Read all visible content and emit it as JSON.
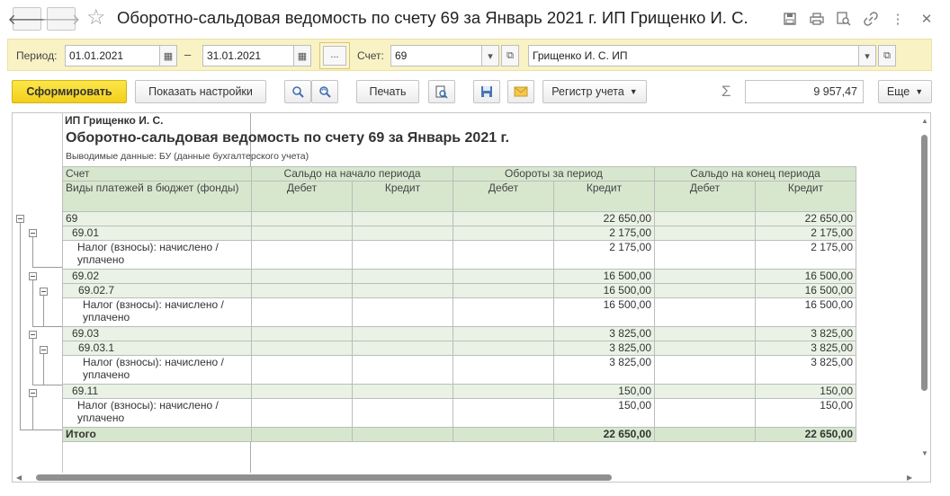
{
  "window": {
    "title": "Оборотно-сальдовая ведомость по счету 69 за Январь 2021 г. ИП Грищенко И. С."
  },
  "filters": {
    "period_label": "Период:",
    "date_from": "01.01.2021",
    "dash": "–",
    "date_to": "31.01.2021",
    "dots": "...",
    "account_label": "Счет:",
    "account": "69",
    "organization": "Грищенко И. С. ИП"
  },
  "toolbar": {
    "generate": "Сформировать",
    "show_settings": "Показать настройки",
    "print": "Печать",
    "register": "Регистр учета",
    "more": "Еще",
    "sum": "9 957,47"
  },
  "report": {
    "org": "ИП Грищенко И. С.",
    "title": "Оборотно-сальдовая ведомость по счету 69 за Январь 2021 г.",
    "subtitle": "Выводимые данные:  БУ (данные бухгалтерского учета)",
    "headers": {
      "account": "Счет",
      "subconto": "Виды платежей в бюджет (фонды)",
      "opening": "Сальдо на начало периода",
      "turnover": "Обороты за период",
      "closing": "Сальдо на конец периода",
      "debit": "Дебет",
      "credit": "Кредит"
    },
    "rows": [
      {
        "name": "69",
        "turnover_credit": "22 650,00",
        "closing_credit": "22 650,00"
      },
      {
        "name": "69.01",
        "turnover_credit": "2 175,00",
        "closing_credit": "2 175,00"
      },
      {
        "name": "Налог (взносы): начислено / уплачено",
        "turnover_credit": "2 175,00",
        "closing_credit": "2 175,00"
      },
      {
        "name": "69.02",
        "turnover_credit": "16 500,00",
        "closing_credit": "16 500,00"
      },
      {
        "name": "69.02.7",
        "turnover_credit": "16 500,00",
        "closing_credit": "16 500,00"
      },
      {
        "name": "Налог (взносы): начислено / уплачено",
        "turnover_credit": "16 500,00",
        "closing_credit": "16 500,00"
      },
      {
        "name": "69.03",
        "turnover_credit": "3 825,00",
        "closing_credit": "3 825,00"
      },
      {
        "name": "69.03.1",
        "turnover_credit": "3 825,00",
        "closing_credit": "3 825,00"
      },
      {
        "name": "Налог (взносы): начислено / уплачено",
        "turnover_credit": "3 825,00",
        "closing_credit": "3 825,00"
      },
      {
        "name": "69.11",
        "turnover_credit": "150,00",
        "closing_credit": "150,00"
      },
      {
        "name": "Налог (взносы): начислено / уплачено",
        "turnover_credit": "150,00",
        "closing_credit": "150,00"
      }
    ],
    "total": {
      "name": "Итого",
      "turnover_credit": "22 650,00",
      "closing_credit": "22 650,00"
    }
  }
}
